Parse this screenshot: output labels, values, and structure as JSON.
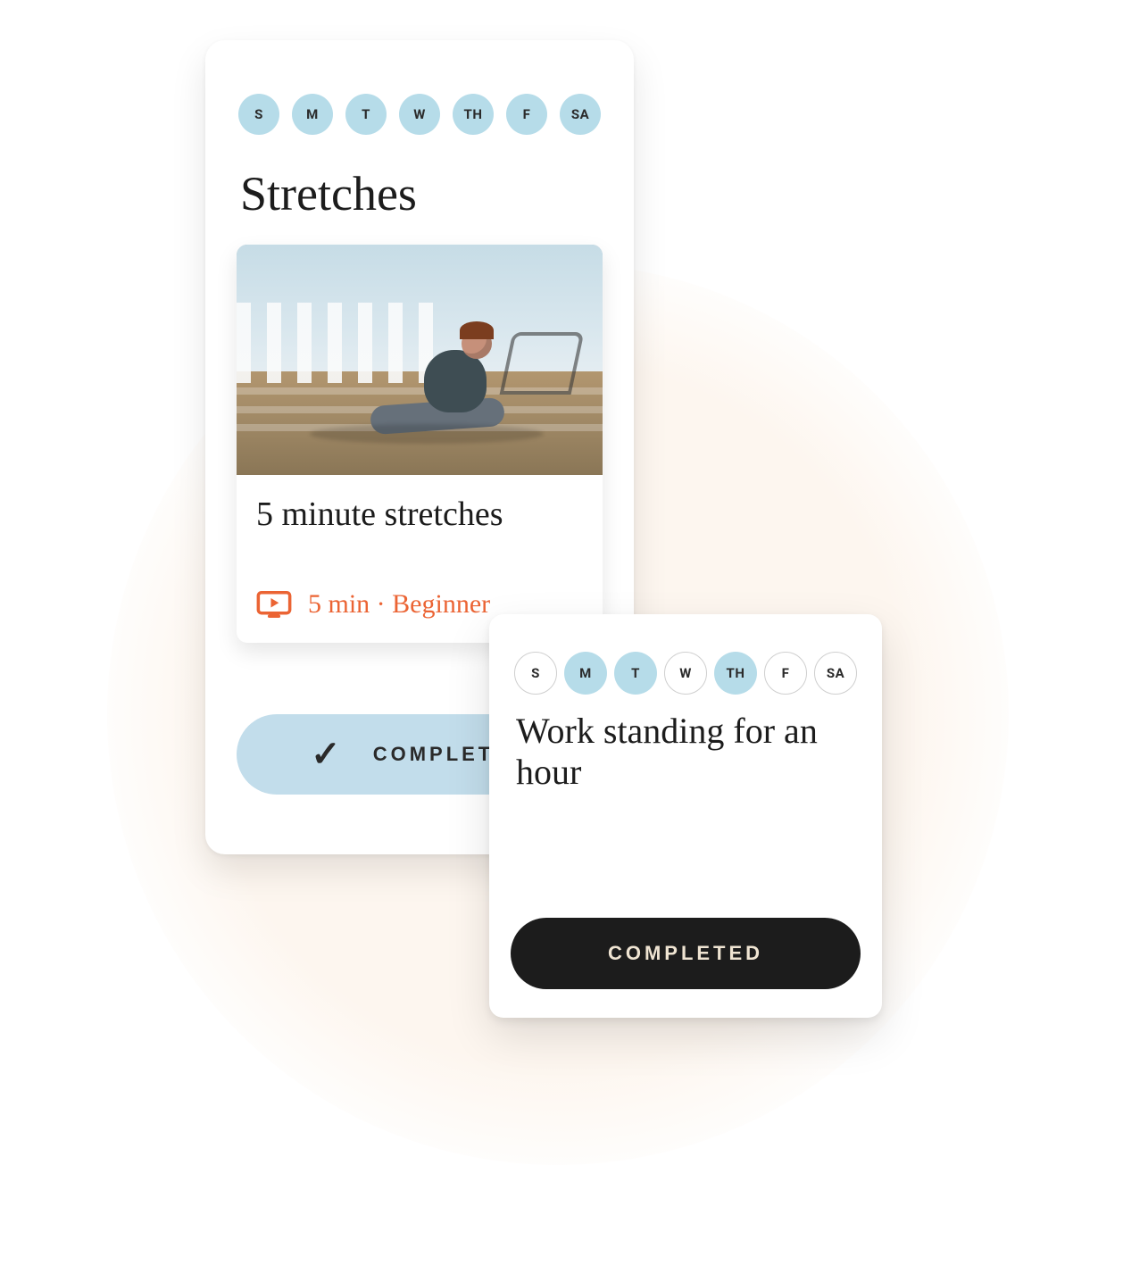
{
  "days": [
    "S",
    "M",
    "T",
    "W",
    "TH",
    "F",
    "SA"
  ],
  "card1": {
    "days_state": [
      "filled",
      "filled",
      "filled",
      "filled",
      "filled",
      "filled",
      "filled"
    ],
    "title": "Stretches",
    "exercise": {
      "name": "5 minute stretches",
      "meta": "5 min · Beginner",
      "icon": "video-play-icon"
    },
    "button_label": "COMPLETED",
    "check_glyph": "✓"
  },
  "card2": {
    "days_state": [
      "outlined",
      "filled",
      "filled",
      "outlined",
      "filled",
      "outlined",
      "outlined"
    ],
    "title": "Work standing for an hour",
    "button_label": "COMPLETED"
  },
  "colors": {
    "accent_blue": "#b6dce9",
    "accent_orange": "#eb6434"
  }
}
